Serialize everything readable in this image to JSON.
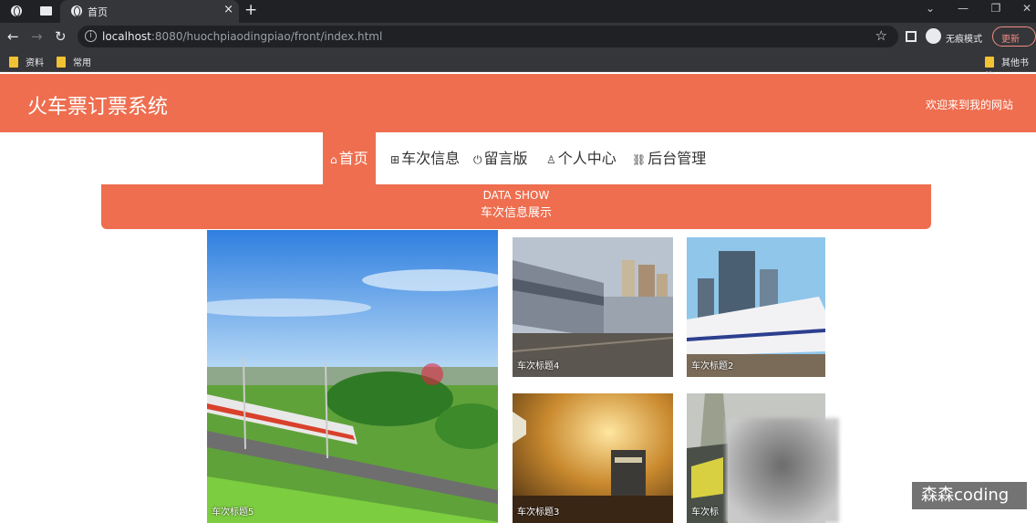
{
  "browser": {
    "tab_title": "首页",
    "tab_close": "×",
    "new_tab": "+",
    "url_host": "localhost",
    "url_rest": ":8080/huochpiaodingpiao/front/index.html",
    "incognito_label": "无痕模式",
    "update_label": "更新",
    "bookmarks": [
      "资料",
      "常用"
    ],
    "other_bookmarks": "其他书签"
  },
  "site": {
    "title": "火车票订票系统",
    "welcome": "欢迎来到我的网站"
  },
  "nav": [
    {
      "label": "首页",
      "icon": "home-icon",
      "glyph": "⌂"
    },
    {
      "label": "车次信息",
      "icon": "grid-icon",
      "glyph": "⊞"
    },
    {
      "label": "留言版",
      "icon": "power-icon",
      "glyph": "⏻"
    },
    {
      "label": "个人中心",
      "icon": "user-icon",
      "glyph": "♙"
    },
    {
      "label": "后台管理",
      "icon": "link-icon",
      "glyph": "🔗"
    }
  ],
  "banner": {
    "en": "DATA SHOW",
    "cn": "车次信息展示"
  },
  "cards": [
    {
      "caption": "车次标题5"
    },
    {
      "caption": "车次标题4"
    },
    {
      "caption": "车次标题2"
    },
    {
      "caption": "车次标题3"
    },
    {
      "caption": "车次标"
    }
  ],
  "watermark": "森森coding",
  "colors": {
    "accent": "#ee6e4f",
    "chrome_dark": "#202124",
    "chrome_mid": "#35363a"
  }
}
